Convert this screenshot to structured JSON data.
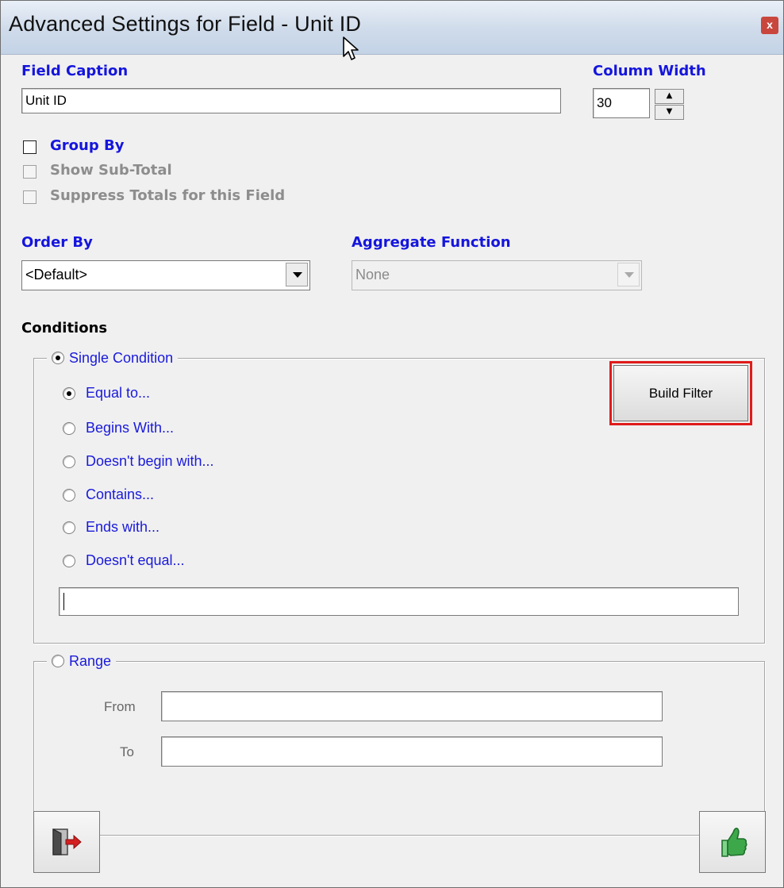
{
  "window": {
    "title": "Advanced Settings for Field - Unit ID",
    "close_glyph": "x"
  },
  "field_caption": {
    "label": "Field Caption",
    "value": "Unit ID"
  },
  "column_width": {
    "label": "Column Width",
    "value": "30"
  },
  "group_by": {
    "label": "Group By",
    "checked": false
  },
  "show_subtotal": {
    "label": "Show Sub-Total",
    "checked": false,
    "enabled": false
  },
  "suppress_totals": {
    "label": "Suppress Totals for this Field",
    "checked": false,
    "enabled": false
  },
  "order_by": {
    "label": "Order By",
    "value": "<Default>"
  },
  "aggregate_function": {
    "label": "Aggregate Function",
    "value": "None",
    "enabled": false
  },
  "conditions": {
    "label": "Conditions",
    "single": {
      "label": "Single Condition",
      "selected": true,
      "build_filter_label": "Build Filter",
      "options": [
        {
          "label": "Equal to...",
          "selected": true
        },
        {
          "label": "Begins With...",
          "selected": false
        },
        {
          "label": "Doesn't begin with...",
          "selected": false
        },
        {
          "label": "Contains...",
          "selected": false
        },
        {
          "label": "Ends with...",
          "selected": false
        },
        {
          "label": "Doesn't equal...",
          "selected": false
        }
      ],
      "value": ""
    },
    "range": {
      "label": "Range",
      "selected": false,
      "from_label": "From",
      "to_label": "To",
      "from_value": "",
      "to_value": ""
    }
  },
  "icons": {
    "exit": "exit-door-icon",
    "ok": "thumbs-up-icon"
  },
  "colors": {
    "label_blue": "#1515dd",
    "highlight_red": "#e01b1b",
    "thumb_green": "#3da84a",
    "exit_arrow_red": "#d42020"
  }
}
